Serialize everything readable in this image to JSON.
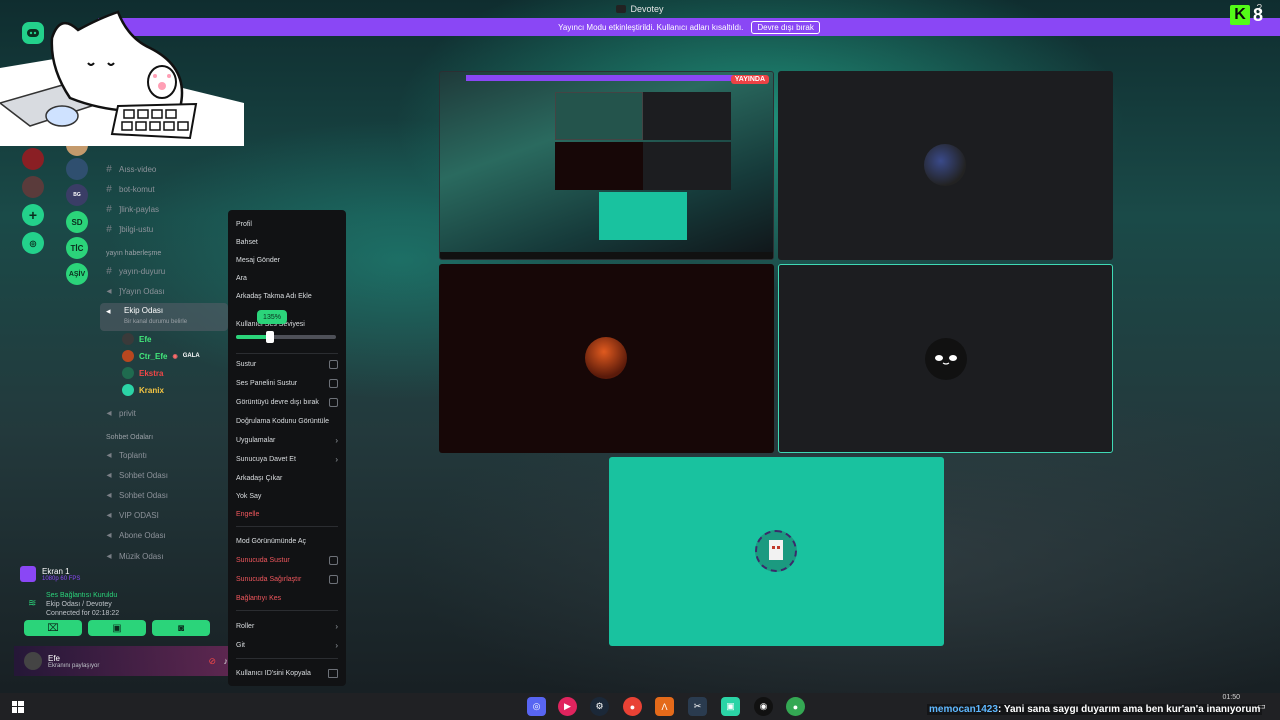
{
  "window": {
    "title": "Devotey"
  },
  "banner": {
    "text": "Yayıncı Modu etkinleştirildi. Kullanıcı adları kısaltıldı.",
    "button": "Devre dışı bırak"
  },
  "kick": {
    "letter": "K",
    "count": "8"
  },
  "servers2": [
    "SD",
    "TİC",
    "AŞİV"
  ],
  "channels": {
    "text": [
      "Aıss-video",
      "bot-komut",
      "]link-paylas",
      "]bilgi-ustu"
    ],
    "category_stream": "yayın haberleşme",
    "stream_channels": [
      "yayın-duyuru",
      "]Yayın Odası"
    ],
    "active_voice": {
      "name": "Ekip Odası",
      "status": "Bir kanal durumu belirle"
    },
    "voice_users": [
      {
        "name": "Efe",
        "color": "#43e97b"
      },
      {
        "name": "Ctr_Efe",
        "badge": "GALA",
        "color": "#43e97b"
      },
      {
        "name": "Ekstra",
        "color": "#f04747"
      },
      {
        "name": "Kranix",
        "color": "#f5c542"
      }
    ],
    "privit": "privit",
    "category_chat": "Sohbet Odaları",
    "chat_channels": [
      "Toplantı",
      "Sohbet Odası",
      "Sohbet Odası",
      "VIP ODASI",
      "Abone Odası",
      "Müzik Odası"
    ]
  },
  "screen_share": {
    "label": "Ekran 1",
    "sub": "1080p 60 FPS"
  },
  "voice_connection": {
    "title": "Ses Bağlantısı Kuruldu",
    "sub": "Ekip Odası / Devotey",
    "time": "Connected for 02:18:22"
  },
  "user": {
    "name": "Efe",
    "status": "Ekranını paylaşıyor"
  },
  "context_menu": {
    "profile": "Profil",
    "mention": "Bahset",
    "message": "Mesaj Gönder",
    "call": "Ara",
    "nickname": "Arkadaş Takma Adı Ekle",
    "volume_label": "Kullanıcı Ses Seviyesi",
    "volume_value": "135%",
    "volume_fraction": 0.35,
    "mute": "Sustur",
    "soundboard": "Ses Panelini Sustur",
    "disable_video": "Görüntüyü devre dışı bırak",
    "verify": "Doğrulama Kodunu Görüntüle",
    "apps": "Uygulamalar",
    "invite": "Sunucuya Davet Et",
    "remove_friend": "Arkadaşı Çıkar",
    "ignore": "Yok Say",
    "block": "Engelle",
    "mod_view": "Mod Görünümünde Aç",
    "server_mute": "Sunucuda Sustur",
    "server_deafen": "Sunucuda Sağırlaştır",
    "disconnect": "Bağlantıyı Kes",
    "roles": "Roller",
    "move": "Git",
    "copy_id": "Kullanıcı ID'sini Kopyala"
  },
  "stream": {
    "live_badge": "YAYINDA"
  },
  "chat_overlay": {
    "user": "memocan1423",
    "message": ": Yani sana saygı duyarım ama ben kur'an'a inanıyorum"
  },
  "clock": {
    "time": "01:50"
  },
  "colors": {
    "accent": "#2bd47a",
    "banner": "#8a47f5",
    "tile_teal": "#19c29f",
    "danger": "#f0575d"
  }
}
